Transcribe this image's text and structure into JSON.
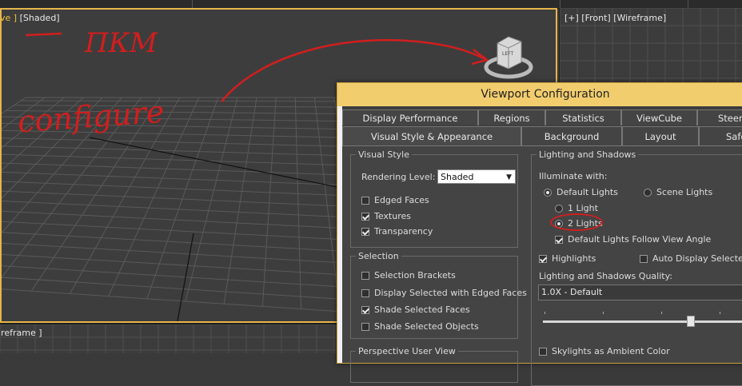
{
  "viewports": {
    "main_label_prefix": "ve ]",
    "main_label_mode": "[Shaded]",
    "front_label": "[+] [Front] [Wireframe]",
    "bottom_left_label": "ireframe ]"
  },
  "annotations": {
    "text1": "ПКМ",
    "text2": "configure"
  },
  "dialog": {
    "title": "Viewport Configuration",
    "tabs_row1": [
      "Display Performance",
      "Regions",
      "Statistics",
      "ViewCube",
      "Steeri"
    ],
    "tabs_row2": [
      "Visual Style & Appearance",
      "Background",
      "Layout",
      "Safe"
    ],
    "visual_style": {
      "title": "Visual Style",
      "rendering_level_label": "Rendering Level:",
      "rendering_level_value": "Shaded",
      "options": [
        {
          "label": "Edged Faces",
          "checked": false
        },
        {
          "label": "Textures",
          "checked": true
        },
        {
          "label": "Transparency",
          "checked": true
        }
      ]
    },
    "selection": {
      "title": "Selection",
      "options": [
        {
          "label": "Selection Brackets",
          "checked": false
        },
        {
          "label": "Display Selected with Edged Faces",
          "checked": false
        },
        {
          "label": "Shade Selected Faces",
          "checked": true
        },
        {
          "label": "Shade Selected Objects",
          "checked": false
        }
      ]
    },
    "perspective_title": "Perspective User View",
    "lighting": {
      "title": "Lighting and Shadows",
      "illuminate_label": "Illuminate with:",
      "default_lights": "Default Lights",
      "scene_lights": "Scene Lights",
      "one_light": "1 Light",
      "two_lights": "2 Lights",
      "follow_view": "Default Lights Follow View Angle",
      "highlights": "Highlights",
      "auto_display": "Auto Display Selected",
      "quality_label": "Lighting and Shadows Quality:",
      "quality_value": "1.0X - Default",
      "quality_level": 0.65,
      "skylights": "Skylights as Ambient Color"
    },
    "viewcube_face": "LEFT"
  }
}
